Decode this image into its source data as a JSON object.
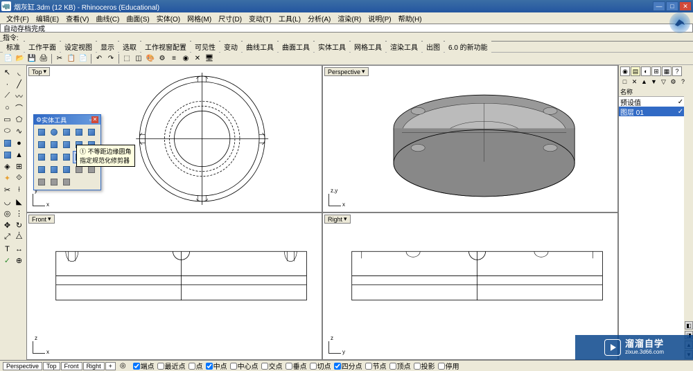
{
  "title": "烟灰缸.3dm (12 KB) - Rhinoceros (Educational)",
  "menu": [
    "文件(F)",
    "编辑(E)",
    "查看(V)",
    "曲线(C)",
    "曲面(S)",
    "实体(O)",
    "网格(M)",
    "尺寸(D)",
    "变动(T)",
    "工具(L)",
    "分析(A)",
    "渲染(R)",
    "说明(P)",
    "帮助(H)"
  ],
  "cmd_history": "自动存档完成",
  "cmd_prompt": "指令:",
  "tabs": [
    "标准",
    "工作平面",
    "设定视图",
    "显示",
    "选取",
    "工作视窗配置",
    "可见性",
    "变动",
    "曲线工具",
    "曲面工具",
    "实体工具",
    "网格工具",
    "渲染工具",
    "出图",
    "6.0 的新功能"
  ],
  "viewports": {
    "top": "Top",
    "perspective": "Perspective",
    "front": "Front",
    "right": "Right"
  },
  "axis_labels": {
    "top": {
      "v": "y",
      "h": "x"
    },
    "perspective": {
      "v": "z,y",
      "h": "x"
    },
    "front": {
      "v": "z",
      "h": "x"
    },
    "right": {
      "v": "z",
      "h": "y"
    }
  },
  "float_palette": {
    "title": "实体工具",
    "tooltip": "① 不等距边缘圆角\n指定规范化修剪器"
  },
  "right_panel": {
    "header_cols": [
      "名称",
      "",
      ""
    ],
    "layers": [
      {
        "name": "预设值",
        "visible": true,
        "color": "#000000",
        "active": false
      },
      {
        "name": "图层 01",
        "visible": true,
        "color": "#ff0000",
        "active": true
      }
    ]
  },
  "status_tabs": [
    "Perspective",
    "Top",
    "Front",
    "Right"
  ],
  "osnap": [
    {
      "label": "端点",
      "checked": true
    },
    {
      "label": "最近点",
      "checked": false
    },
    {
      "label": "点",
      "checked": false
    },
    {
      "label": "中点",
      "checked": true
    },
    {
      "label": "中心点",
      "checked": false
    },
    {
      "label": "交点",
      "checked": false
    },
    {
      "label": "垂点",
      "checked": false
    },
    {
      "label": "切点",
      "checked": false
    },
    {
      "label": "四分点",
      "checked": true
    },
    {
      "label": "节点",
      "checked": false
    },
    {
      "label": "顶点",
      "checked": false
    },
    {
      "label": "投影",
      "checked": false
    },
    {
      "label": "停用",
      "checked": false
    }
  ],
  "status_extra": "◎",
  "watermark": {
    "main": "溜溜自学",
    "sub": "zixue.3d66.com"
  }
}
